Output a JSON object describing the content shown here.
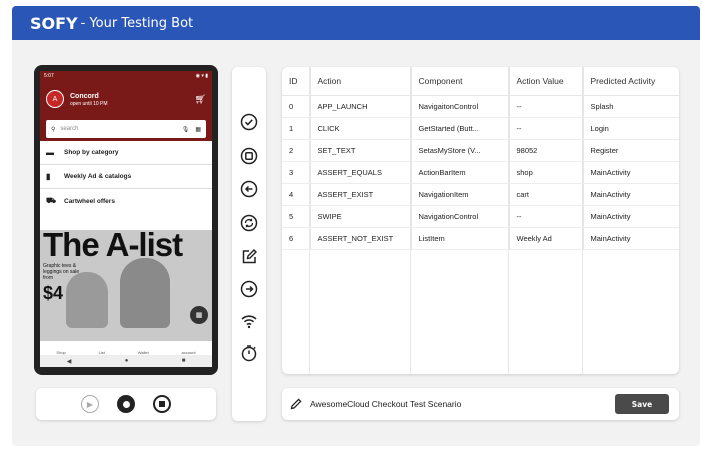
{
  "app": {
    "brand": "SOFY",
    "tagline": "- Your Testing Bot"
  },
  "phone": {
    "status_time": "5:07",
    "store_initial": "A",
    "store_name": "Concord",
    "store_hours": "open until 10 PM",
    "search_placeholder": "search",
    "menu": [
      "Shop by category",
      "Weekly Ad & catalogs",
      "Cartwheel offers"
    ],
    "promo_title": "The A-list",
    "promo_text": "Graphic tees & leggings on sale from",
    "promo_price": "$4",
    "bottom_nav": [
      "Shop",
      "List",
      "Wallet",
      "account"
    ]
  },
  "tools": [
    "check-circle-icon",
    "stop-square-icon",
    "back-arrow-icon",
    "refresh-icon",
    "edit-icon",
    "forward-arrow-icon",
    "wifi-icon",
    "timer-icon"
  ],
  "table": {
    "headers": [
      "ID",
      "Action",
      "Component",
      "Action Value",
      "Predicted Activity"
    ],
    "rows": [
      [
        "0",
        "APP_LAUNCH",
        "NavigaitonControl",
        "--",
        "Splash"
      ],
      [
        "1",
        "CLICK",
        "GetStarted (Butt...",
        "--",
        "Login"
      ],
      [
        "2",
        "SET_TEXT",
        "SetasMyStore (V...",
        "98052",
        "Register"
      ],
      [
        "3",
        "ASSERT_EQUALS",
        "ActionBarItem",
        "shop",
        "MainActivity"
      ],
      [
        "4",
        "ASSERT_EXIST",
        "NavigationItem",
        "cart",
        "MainActivity"
      ],
      [
        "5",
        "SWIPE",
        "NavigationControl",
        "--",
        "MainActivity"
      ],
      [
        "6",
        "ASSERT_NOT_EXIST",
        "ListItem",
        "Weekly Ad",
        "MainActivity"
      ]
    ]
  },
  "scenario": {
    "name": "AwesomeCloud Checkout Test Scenario",
    "save_label": "Save"
  }
}
